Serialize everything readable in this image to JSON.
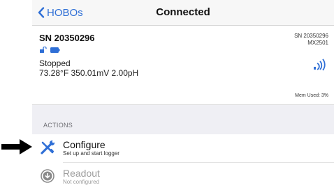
{
  "navbar": {
    "back_label": "HOBOs",
    "title": "Connected"
  },
  "device": {
    "serial_title": "SN 20350296",
    "serial_small": "SN 20350296",
    "model": "MX2501",
    "status": "Stopped",
    "readings": "73.28°F 350.01mV 2.00pH",
    "memory": "Mem Used: 3%",
    "icons": [
      "unlocked-lock-icon",
      "battery-icon",
      "bluetooth-signal-icon"
    ]
  },
  "actions": {
    "header": "ACTIONS",
    "items": [
      {
        "title": "Configure",
        "subtitle": "Set up and start logger",
        "icon": "wrench-screwdriver-icon",
        "enabled": true
      },
      {
        "title": "Readout",
        "subtitle": "Not configured",
        "icon": "download-circle-icon",
        "enabled": false
      }
    ]
  },
  "annotation": {
    "icon": "pointer-arrow-icon"
  },
  "colors": {
    "accent": "#2f6fd6",
    "disabled": "#9d9d9d",
    "group_background": "#efeff4"
  }
}
